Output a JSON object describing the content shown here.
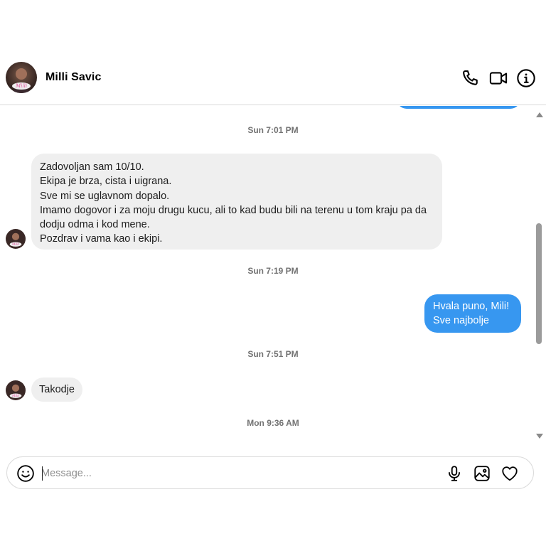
{
  "header": {
    "contact_name": "Milli Savic",
    "icons": [
      "phone-icon",
      "video-call-icon",
      "info-icon"
    ]
  },
  "thread": {
    "items": [
      {
        "kind": "timestamp",
        "text": "Sun 7:01 PM"
      },
      {
        "kind": "incoming",
        "text": "Zadovoljan sam 10/10.\nEkipa je brza, cista i uigrana.\nSve mi se uglavnom dopalo.\nImamo dogovor i za moju drugu kucu, ali to kad budu bili na terenu u tom kraju pa da dodju odma i kod mene.\nPozdrav i vama kao i ekipi."
      },
      {
        "kind": "timestamp",
        "text": "Sun 7:19 PM"
      },
      {
        "kind": "outgoing",
        "text": "Hvala puno, Mili!\nSve najbolje"
      },
      {
        "kind": "timestamp",
        "text": "Sun 7:51 PM"
      },
      {
        "kind": "incoming",
        "text": "Takodje"
      },
      {
        "kind": "timestamp",
        "text": "Mon 9:36 AM"
      }
    ]
  },
  "composer": {
    "placeholder": "Message...",
    "value": "",
    "icons": [
      "emoji-icon",
      "microphone-icon",
      "image-icon",
      "heart-icon"
    ]
  },
  "colors": {
    "outgoing_bubble": "#3797f0",
    "incoming_bubble": "#efefef",
    "timestamp_text": "#737373",
    "divider": "#dbdbdb"
  }
}
